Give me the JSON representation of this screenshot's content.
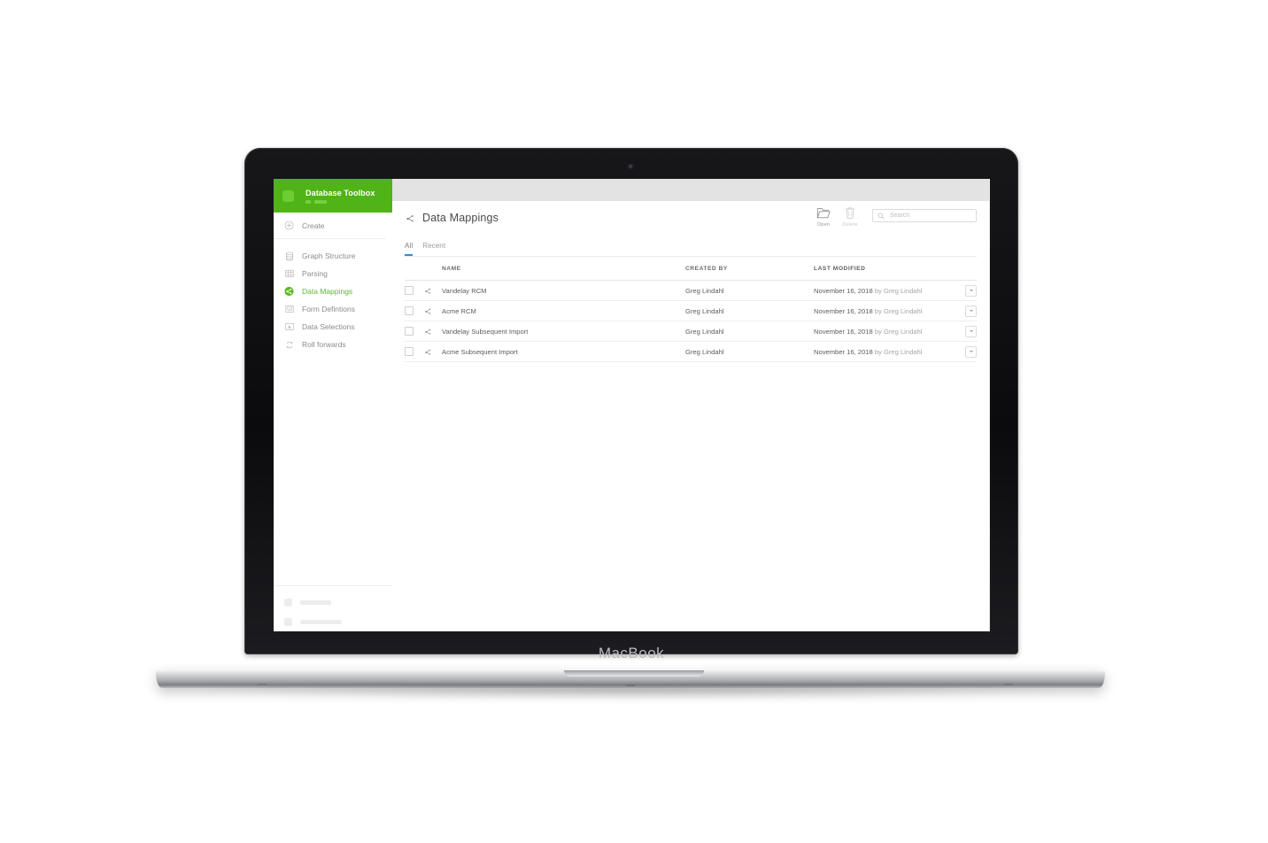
{
  "device": {
    "name": "MacBook",
    "webcam": "webcam-dot"
  },
  "sidebar": {
    "brand": {
      "title": "Database Toolbox",
      "logo_icon": "app-logo-icon",
      "accent_color": "#50b318"
    },
    "create": {
      "label": "Create",
      "icon": "plus-circle-icon"
    },
    "items": [
      {
        "label": "Graph Structure",
        "icon": "database-icon",
        "active": false
      },
      {
        "label": "Parsing",
        "icon": "grid-table-icon",
        "active": false
      },
      {
        "label": "Data Mappings",
        "icon": "node-graph-icon",
        "active": true
      },
      {
        "label": "Form Defintions",
        "icon": "form-icon",
        "active": false
      },
      {
        "label": "Data Selections",
        "icon": "selection-cursor-icon",
        "active": false
      },
      {
        "label": "Roll forwards",
        "icon": "refresh-arrows-icon",
        "active": false
      }
    ],
    "active_color": "#5cbb2a"
  },
  "page": {
    "title": "Data Mappings",
    "title_icon": "node-graph-icon"
  },
  "toolbar": {
    "open": {
      "label": "Open",
      "icon": "folder-open-icon",
      "disabled": false
    },
    "delete": {
      "label": "Delete",
      "icon": "trash-icon",
      "disabled": true
    },
    "search": {
      "placeholder": "Search",
      "value": "",
      "icon": "search-icon"
    }
  },
  "tabs": [
    {
      "label": "All",
      "active": true
    },
    {
      "label": "Recent",
      "active": false
    }
  ],
  "table": {
    "columns": [
      "NAME",
      "CREATED BY",
      "LAST MODIFIED"
    ],
    "rows": [
      {
        "name": "Vandelay RCM",
        "created_by": "Greg Lindahl",
        "modified_date": "November 16, 2018",
        "modified_by": "by Greg Lindahl",
        "icon": "node-graph-icon",
        "checked": false
      },
      {
        "name": "Acme RCM",
        "created_by": "Greg Lindahl",
        "modified_date": "November 16, 2018",
        "modified_by": "by Greg Lindahl",
        "icon": "node-graph-icon",
        "checked": false
      },
      {
        "name": "Vandelay Subsequent Import",
        "created_by": "Greg Lindahl",
        "modified_date": "November 16, 2018",
        "modified_by": "by Greg Lindahl",
        "icon": "node-graph-icon",
        "checked": false
      },
      {
        "name": "Acme Subsequent Import",
        "created_by": "Greg Lindahl",
        "modified_date": "November 16, 2018",
        "modified_by": "by Greg Lindahl",
        "icon": "node-graph-icon",
        "checked": false
      }
    ]
  }
}
